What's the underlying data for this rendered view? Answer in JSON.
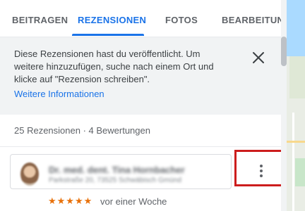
{
  "tabs": [
    {
      "label": "BEITRAGEN",
      "active": false
    },
    {
      "label": "REZENSIONEN",
      "active": true
    },
    {
      "label": "FOTOS",
      "active": false
    },
    {
      "label": "BEARBEITUN...",
      "active": false
    }
  ],
  "notice": {
    "text": "Diese Rezensionen hast du veröffentlicht. Um weitere hinzuzufügen, suche nach einem Ort und klicke auf \"Rezension schreiben\".",
    "link": "Weitere Informationen"
  },
  "summary": "25 Rezensionen · 4 Bewertungen",
  "review": {
    "place_name": "Dr. med. dent. Tina Hornbacher",
    "place_address": "Parkstraße 20, 73525 Schwäbisch Gmünd",
    "rating": 5,
    "stars": "★★★★★",
    "time": "vor einer Woche"
  },
  "colors": {
    "accent": "#1a73e8",
    "highlight_box": "#cc1d1d",
    "stars": "#e8710a"
  },
  "icons": {
    "close": "close-icon",
    "more": "more-vert-icon"
  }
}
